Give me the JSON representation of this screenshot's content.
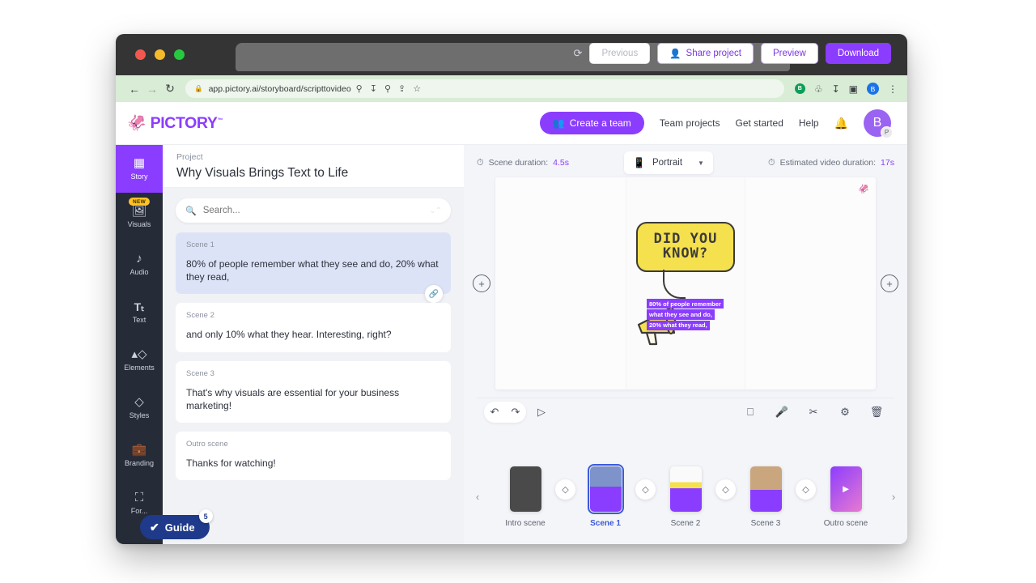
{
  "browser": {
    "back_icon": "back-arrow-icon",
    "forward_icon": "forward-arrow-icon",
    "reload_icon": "reload-icon",
    "lock_icon": "lock-icon",
    "url": "app.pictory.ai/storyboard/scripttovideo",
    "omni_icons": [
      "key-icon",
      "install-icon",
      "zoom-icon",
      "share-icon",
      "bookmark-star-icon"
    ],
    "ext_icons": [
      "extension-green-icon",
      "puzzle-icon",
      "download-icon",
      "sidepanel-icon"
    ],
    "profile_initial": "B",
    "menu_icon": "kebab-menu-icon"
  },
  "header": {
    "logo_text": "PICTORY",
    "logo_tm": "™",
    "logo_mark": "octopus-icon",
    "create_team_label": "Create a team",
    "links": [
      "Team projects",
      "Get started",
      "Help"
    ],
    "bell_icon": "bell-icon",
    "avatar_initial": "B",
    "avatar_badge": "P"
  },
  "rail": {
    "items": [
      {
        "label": "Story",
        "icon": "grid-icon",
        "badge": ""
      },
      {
        "label": "Visuals",
        "icon": "image-icon",
        "badge": "NEW"
      },
      {
        "label": "Audio",
        "icon": "music-note-icon",
        "badge": ""
      },
      {
        "label": "Text",
        "icon": "text-icon",
        "badge": ""
      },
      {
        "label": "Elements",
        "icon": "shapes-icon",
        "badge": ""
      },
      {
        "label": "Styles",
        "icon": "layers-style-icon",
        "badge": ""
      },
      {
        "label": "Branding",
        "icon": "briefcase-icon",
        "badge": ""
      },
      {
        "label": "For...",
        "icon": "format-icon",
        "badge": ""
      }
    ],
    "active_index": 0,
    "guide_label": "Guide",
    "guide_count": "5",
    "guide_icon": "check-circle-icon"
  },
  "project": {
    "sub_label": "Project",
    "title": "Why Visuals Brings Text to Life",
    "spinner_icon": "loading-spinner-icon",
    "previous_label": "Previous",
    "share_label": "Share project",
    "share_icon": "person-add-icon",
    "preview_label": "Preview",
    "download_label": "Download"
  },
  "search": {
    "placeholder": "Search...",
    "value": "",
    "icon": "search-icon",
    "chevrons": "⌄⌃"
  },
  "scenes": [
    {
      "label": "Scene 1",
      "text": "80% of people remember what they see and do, 20% what they read,",
      "active": true
    },
    {
      "label": "Scene 2",
      "text": "and only 10% what they hear. Interesting, right?",
      "active": false
    },
    {
      "label": "Scene 3",
      "text": "That's why visuals are essential for your business marketing!",
      "active": false
    },
    {
      "label": "Outro scene",
      "text": "Thanks for watching!",
      "active": false
    }
  ],
  "link_badge_icon": "link-icon",
  "meta": {
    "scene_duration_label": "Scene duration:",
    "scene_duration_value": "4.5s",
    "estimated_label": "Estimated video duration:",
    "estimated_value": "17s",
    "clock_icon": "clock-icon",
    "ratio_value": "Portrait",
    "ratio_icon": "phone-portrait-icon",
    "caret_icon": "chevron-down-icon"
  },
  "canvas": {
    "add_left_icon": "plus-circle-icon",
    "add_right_icon": "plus-circle-icon",
    "watermark_icon": "octopus-icon",
    "bubble_line1": "DID YOU",
    "bubble_line2": "KNOW?",
    "caption_lines": [
      "80% of people remember",
      "what they see and do,",
      "20% what they read,"
    ]
  },
  "edit_toolbar": {
    "undo_icon": "undo-icon",
    "redo_icon": "redo-icon",
    "play_icon": "play-circle-icon",
    "right_icons": [
      "captions-cc-icon",
      "microphone-icon",
      "scissors-icon",
      "gear-icon",
      "trash-icon"
    ]
  },
  "timeline": {
    "prev_icon": "chevron-left-icon",
    "next_icon": "chevron-right-icon",
    "transition_icon": "transition-layers-icon",
    "items": [
      {
        "label": "Intro scene",
        "selected": false,
        "eye": "eye-off-icon",
        "thumb": "dark"
      },
      {
        "label": "Scene 1",
        "selected": true,
        "eye": "",
        "thumb": "blue"
      },
      {
        "label": "Scene 2",
        "selected": false,
        "eye": "",
        "thumb": "light"
      },
      {
        "label": "Scene 3",
        "selected": false,
        "eye": "",
        "thumb": "person"
      },
      {
        "label": "Outro scene",
        "selected": false,
        "eye": "eye-on-icon",
        "thumb": "gradient"
      }
    ]
  },
  "colors": {
    "brand_purple": "#8b3dff",
    "rail_dark": "#262b38",
    "accent_blue": "#3b5bdb",
    "bubble_yellow": "#f5e04e"
  }
}
